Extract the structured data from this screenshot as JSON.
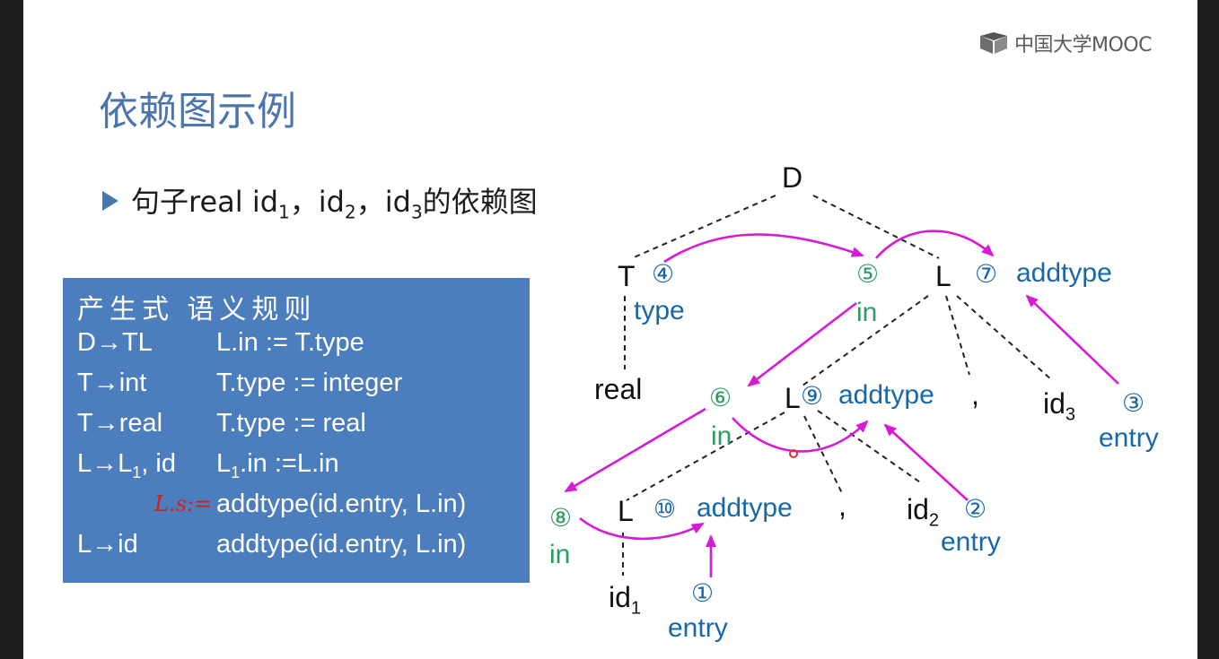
{
  "logo": {
    "text": "中国大学MOOC",
    "icon": "mooc-logo-icon"
  },
  "title": "依赖图示例",
  "bullet": {
    "prefix": "句子real  id",
    "s1": "1",
    "c1": "，id",
    "s2": "2",
    "c2": "，id",
    "s3": "3",
    "suffix": "的依赖图"
  },
  "rules": {
    "header": "产生式  语义规则",
    "rows": [
      {
        "p": "D→TL",
        "p_sub": "",
        "p_tail": "",
        "s": "L.in := T.type",
        "s_sub": "",
        "s_tail": ""
      },
      {
        "p": "T→int",
        "p_sub": "",
        "p_tail": "",
        "s": "T.type := integer",
        "s_sub": "",
        "s_tail": ""
      },
      {
        "p": "T→real",
        "p_sub": "",
        "p_tail": "",
        "s": "T.type := real",
        "s_sub": "",
        "s_tail": ""
      },
      {
        "p": "L→L",
        "p_sub": "1",
        "p_tail": ", id",
        "s": "L",
        "s_sub": "1",
        "s_tail": ".in :=L.in"
      },
      {
        "p": "",
        "p_sub": "",
        "p_tail": "",
        "s": "addtype(id.entry, L.in)",
        "s_sub": "",
        "s_tail": ""
      },
      {
        "p": "L→id",
        "p_sub": "",
        "p_tail": "",
        "s": "addtype(id.entry, L.in)",
        "s_sub": "",
        "s_tail": ""
      }
    ],
    "handwritten": "L.s:="
  },
  "tree": {
    "D": "D",
    "T": "T",
    "L": "L",
    "real": "real",
    "comma": ",",
    "id": "id",
    "sub1": "1",
    "sub2": "2",
    "sub3": "3",
    "n1": "①",
    "n2": "②",
    "n3": "③",
    "n4": "④",
    "n5": "⑤",
    "n6": "⑥",
    "n7": "⑦",
    "n8": "⑧",
    "n9": "⑨",
    "n10": "⑩",
    "type": "type",
    "in": "in",
    "addtype": "addtype",
    "entry": "entry"
  },
  "colors": {
    "title": "#4a76ad",
    "panel": "#4c7ebd",
    "attr_blue": "#1867a8",
    "attr_green": "#2e9a64",
    "arrow": "#d61ad6",
    "handwriting": "#d21d1d"
  }
}
